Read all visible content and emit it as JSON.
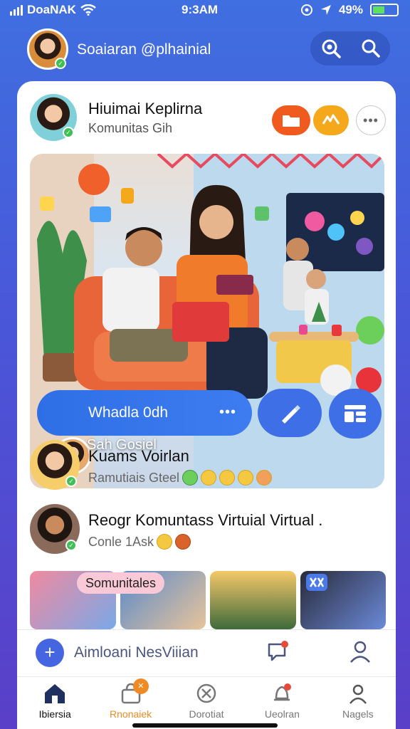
{
  "status_bar": {
    "carrier": "DoaNAK",
    "time": "9:3AM",
    "battery": "49%",
    "battery_level": 0.49
  },
  "header": {
    "title": "Soaiaran @plhainial",
    "actions": [
      "search-zoom-icon",
      "search-icon"
    ]
  },
  "post": {
    "title": "Hiuimai Keplirna",
    "subtitle": "Komunitas   Gih",
    "hero_label": "Sah Gosiel",
    "hero_pill_text": "Whadla 0dh",
    "hero_pill_more": "•••",
    "more": "•••"
  },
  "feed": [
    {
      "name": "Kuams Voirlan",
      "meta": "Ramutiais Gteel",
      "emojis": 5
    },
    {
      "name": "Reogr Komuntass Virtuial Virtual .",
      "meta": "Conle 1Ask",
      "emojis": 2
    }
  ],
  "gallery": {
    "label": "Somunitales"
  },
  "composer": {
    "placeholder": "Aimloani NesViiian"
  },
  "tabs": [
    {
      "label": "Ibiersia",
      "icon": "home-icon",
      "active": true
    },
    {
      "label": "Rnonaiek",
      "icon": "bag-icon",
      "badge": "✕"
    },
    {
      "label": "Dorotiat",
      "icon": "compass-icon"
    },
    {
      "label": "Ueolran",
      "icon": "bell-icon"
    },
    {
      "label": "Nagels",
      "icon": "profile-icon"
    }
  ],
  "colors": {
    "accent": "#3f6fe6",
    "background_top": "#3f6fe0",
    "background_bottom": "#5a3fc8",
    "online": "#3fbf55",
    "orange": "#f05a1e",
    "yellow": "#f5a81c"
  }
}
